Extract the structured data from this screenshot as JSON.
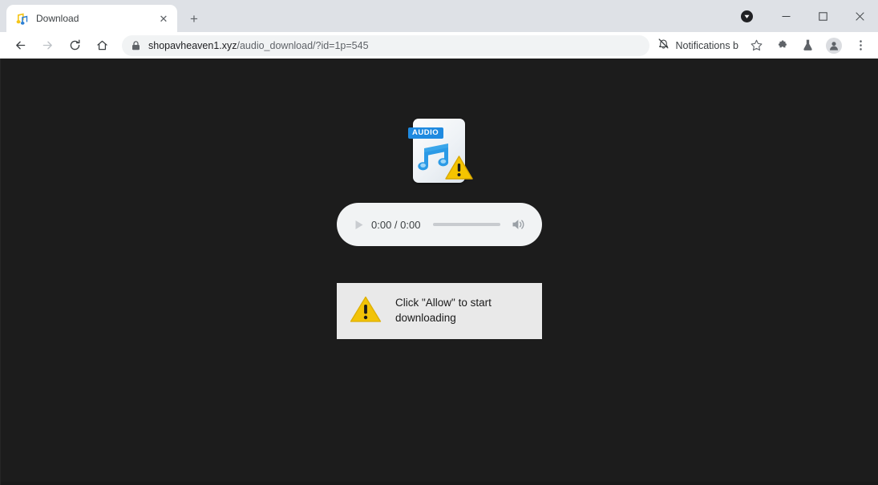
{
  "window": {
    "controls": {
      "minimize_label": "—",
      "maximize_label": "□",
      "close_label": "✕"
    },
    "download_indicator_name": "download-indicator"
  },
  "tabstrip": {
    "tabs": [
      {
        "title": "Download",
        "favicon": "music-note-favicon",
        "close_label": "✕",
        "active": true
      }
    ],
    "new_tab_label": "+"
  },
  "toolbar": {
    "back_icon": "back-arrow-icon",
    "forward_icon": "forward-arrow-icon",
    "reload_icon": "reload-icon",
    "home_icon": "home-icon",
    "omnibox": {
      "lock_icon": "lock-icon",
      "url_host": "shopavheaven1.xyz",
      "url_path": "/audio_download/?id=1p=545",
      "url_full": "shopavheaven1.xyz/audio_download/?id=1p=545"
    },
    "notifications_chip": {
      "icon": "bell-off-icon",
      "label": "Notifications b"
    },
    "bookmark_icon": "star-icon",
    "extensions_icon": "puzzle-piece-icon",
    "labs_icon": "flask-icon",
    "profile_icon": "avatar-icon",
    "menu_icon": "three-dot-menu-icon"
  },
  "page": {
    "background_color": "#1c1c1c",
    "file_icon": {
      "name": "audio-file-warning-icon",
      "badge_label": "AUDIO",
      "badge_color": "#1f8ae0",
      "note_color": "#2b9ae6",
      "warning_color": "#f5c400"
    },
    "audio_player": {
      "play_label": "play-button",
      "current_time": "0:00",
      "duration": "0:00",
      "time_display": "0:00 / 0:00",
      "seek_value": 0,
      "volume_icon": "volume-icon",
      "background_color": "#f1f3f4"
    },
    "notice": {
      "warning_icon": "warning-triangle-icon",
      "line1": "Click \"Allow\" to start",
      "line2": "downloading",
      "background_color": "#e9e9e9"
    }
  }
}
